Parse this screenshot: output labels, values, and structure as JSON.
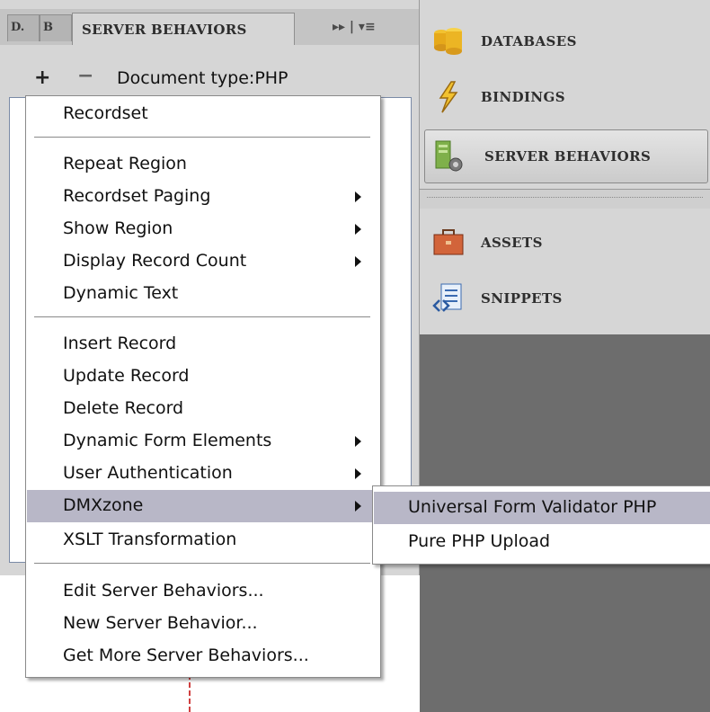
{
  "panel": {
    "tab_stub_1": "D.",
    "tab_stub_2": "B",
    "active_tab": "SERVER BEHAVIORS",
    "tab_buttons": "▸▸ | ▾≡",
    "add_symbol": "+",
    "remove_symbol": "−",
    "document_type": "Document type:PHP"
  },
  "right_panel": {
    "items": [
      {
        "label": "DATABASES",
        "icon": "database-icon"
      },
      {
        "label": "BINDINGS",
        "icon": "lightning-icon"
      },
      {
        "label": "SERVER BEHAVIORS",
        "icon": "server-gear-icon"
      },
      {
        "label": "ASSETS",
        "icon": "briefcase-icon"
      },
      {
        "label": "SNIPPETS",
        "icon": "snippet-icon"
      }
    ]
  },
  "menu": {
    "items": [
      {
        "label": "Recordset"
      },
      {
        "label": "Repeat Region"
      },
      {
        "label": "Recordset Paging",
        "submenu": true
      },
      {
        "label": "Show Region",
        "submenu": true
      },
      {
        "label": "Display Record Count",
        "submenu": true
      },
      {
        "label": "Dynamic Text"
      },
      {
        "label": "Insert Record"
      },
      {
        "label": "Update Record"
      },
      {
        "label": "Delete Record"
      },
      {
        "label": "Dynamic Form Elements",
        "submenu": true
      },
      {
        "label": "User Authentication",
        "submenu": true
      },
      {
        "label": "DMXzone",
        "submenu": true,
        "highlighted": true
      },
      {
        "label": "XSLT Transformation"
      },
      {
        "label": "Edit Server Behaviors..."
      },
      {
        "label": "New Server Behavior..."
      },
      {
        "label": "Get More Server Behaviors..."
      }
    ]
  },
  "submenu": {
    "items": [
      {
        "label": "Universal Form Validator PHP",
        "highlighted": true
      },
      {
        "label": "Pure PHP Upload"
      }
    ]
  },
  "colors": {
    "highlight": "#b8b7c7",
    "panel_bg": "#d6d6d6",
    "dark_bg": "#6d6d6d"
  }
}
